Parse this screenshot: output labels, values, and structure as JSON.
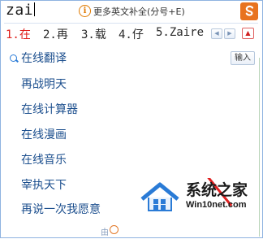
{
  "composition": {
    "pinyin": "zai",
    "hint_text": "更多英文补全(分号+E)"
  },
  "candidates": [
    {
      "index": "1.",
      "text": "在",
      "active": true
    },
    {
      "index": "2.",
      "text": "再",
      "active": false
    },
    {
      "index": "3.",
      "text": "载",
      "active": false
    },
    {
      "index": "4.",
      "text": "仔",
      "active": false
    },
    {
      "index": "5.",
      "text": "Zaire",
      "active": false
    }
  ],
  "pager": {
    "prev_icon": "triangle-left",
    "next_icon": "triangle-right",
    "expand_icon": "triangle-up"
  },
  "suggestions": {
    "input_button": "输入",
    "items": [
      "在线翻译",
      "再战明天",
      "在线计算器",
      "在线漫画",
      "在线音乐",
      "宰执天下",
      "再说一次我愿意"
    ]
  },
  "footer": {
    "by_text": "由"
  },
  "watermark": {
    "title": "系统之家",
    "url": "Win10net.com"
  },
  "colors": {
    "active_candidate": "#e0201c",
    "suggestion_text": "#1c4f8e",
    "border": "#8fb3e0",
    "logo_orange": "#e8731f",
    "arrow_red": "#e02020"
  }
}
